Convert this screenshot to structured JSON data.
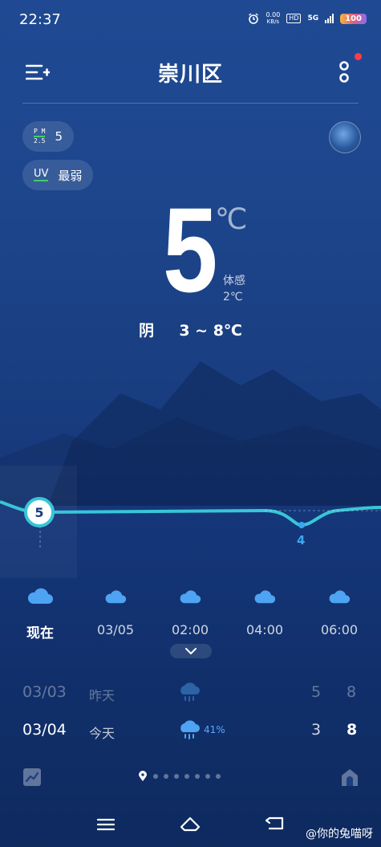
{
  "status_bar": {
    "time": "22:37",
    "net_speed_value": "0.00",
    "net_speed_unit": "KB/s",
    "hd_label": "HD",
    "network": "5G",
    "battery": "100"
  },
  "header": {
    "city": "崇川区"
  },
  "air": {
    "pm_label_top": "P M",
    "pm_label_bottom": "2.5",
    "pm_value": "5",
    "uv_label": "UV",
    "uv_value": "最弱"
  },
  "current": {
    "temp": "5",
    "unit": "℃",
    "feels_label": "体感",
    "feels_value": "2℃",
    "condition": "阴",
    "range": "3 ~ 8℃"
  },
  "hourly": {
    "items": [
      {
        "label": "现在",
        "icon": "cloud-icon"
      },
      {
        "label": "03/05",
        "icon": "cloud-icon"
      },
      {
        "label": "02:00",
        "icon": "cloud-icon"
      },
      {
        "label": "04:00",
        "icon": "cloud-icon"
      },
      {
        "label": "06:00",
        "icon": "cloud-icon"
      }
    ],
    "now_temp_marker": "5",
    "min_temp_marker": "4"
  },
  "daily": [
    {
      "date": "03/03",
      "relative": "昨天",
      "icon": "rain-cloud-icon",
      "precip": "",
      "low": "5",
      "high": "8"
    },
    {
      "date": "03/04",
      "relative": "今天",
      "icon": "rain-cloud-icon",
      "precip": "41%",
      "low": "3",
      "high": "8"
    }
  ],
  "page_indicator": {
    "count": 7,
    "active": 0
  },
  "watermark": "@你的兔喵呀",
  "colors": {
    "accent_line": "#38c6d6",
    "min_marker": "#3aa8f0",
    "precip_text": "#5ba9ff",
    "notify_dot": "#ff3b4a"
  }
}
